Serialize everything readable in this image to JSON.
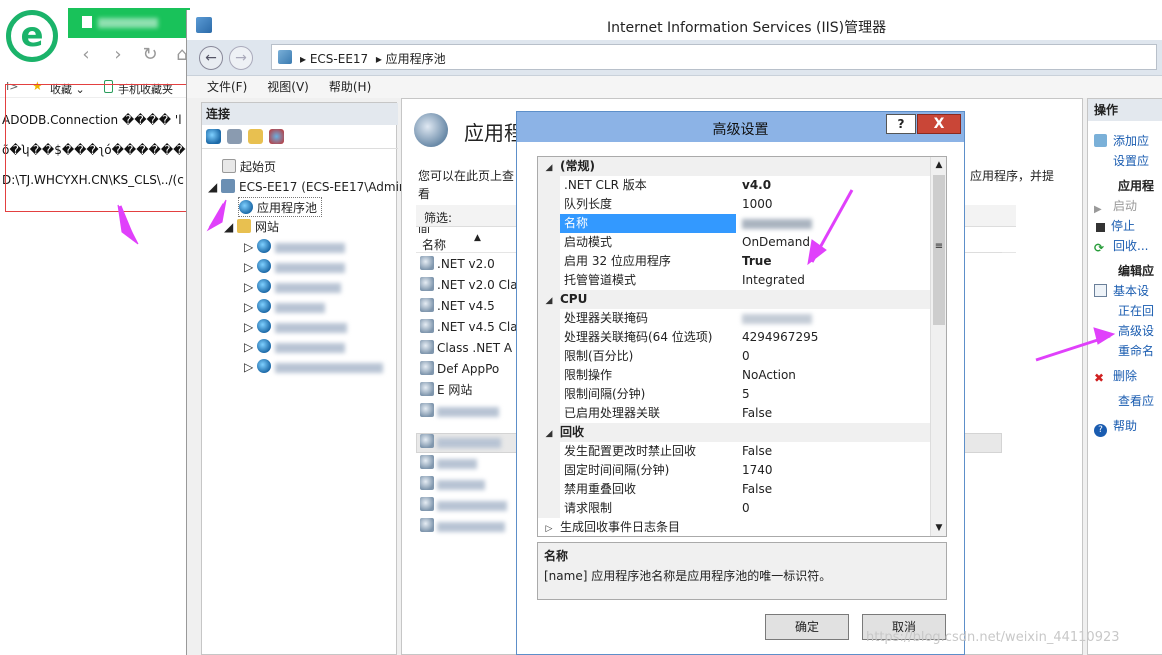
{
  "browser": {
    "logo_letter": "e",
    "bookmarks": {
      "separator": "I>",
      "favorites": "收藏",
      "mobile_favorites": "手机收藏夹"
    },
    "content_lines": [
      "ADODB.Connection  ���� 'l",
      "õ�ʮ��$���ʅó�������",
      "D:\\TJ.WHCYXH.CN\\KS_CLS\\../(c"
    ]
  },
  "iis": {
    "title": "Internet Information Services (IIS)管理器",
    "breadcrumb": [
      "ECS-EE17",
      "应用程序池"
    ],
    "menu": [
      "文件(F)",
      "视图(V)",
      "帮助(H)"
    ],
    "connections": {
      "header": "连接",
      "tree": {
        "start_page": "起始页",
        "server": "ECS-EE17 (ECS-EE17\\Admir",
        "app_pools": "应用程序池",
        "sites": "网站"
      }
    },
    "center": {
      "title": "应用程",
      "desc_left": "您可以在此页上查看\n供不同应用程序之间",
      "desc_right": "应用程序，并提",
      "filter_label": "筛选:",
      "column_name": "名称",
      "pools": [
        ".NET v2.0",
        ".NET v2.0 Clas",
        ".NET v4.5",
        ".NET v4.5 Clas",
        "Class   .NET A",
        "Def   AppPo",
        "E        网站"
      ]
    },
    "actions": {
      "header": "操作",
      "items": [
        {
          "label": "添加应",
          "kind": "link"
        },
        {
          "label": "设置应",
          "kind": "link"
        },
        {
          "label": "应用程",
          "kind": "header"
        },
        {
          "label": "启动",
          "kind": "disabled"
        },
        {
          "label": "停止",
          "kind": "link"
        },
        {
          "label": "回收...",
          "kind": "link"
        },
        {
          "label": "编辑应",
          "kind": "header"
        },
        {
          "label": "基本设",
          "kind": "link"
        },
        {
          "label": "正在回",
          "kind": "link"
        },
        {
          "label": "高级设",
          "kind": "link"
        },
        {
          "label": "重命名",
          "kind": "link"
        },
        {
          "label": "删除",
          "kind": "link"
        },
        {
          "label": "查看应",
          "kind": "link"
        },
        {
          "label": "帮助",
          "kind": "link"
        }
      ]
    }
  },
  "dialog": {
    "title": "高级设置",
    "help_glyph": "?",
    "close_glyph": "X",
    "categories": {
      "general": "(常规)",
      "cpu": "CPU",
      "recycling": "回收"
    },
    "general": [
      {
        "key": ".NET CLR 版本",
        "value": "v4.0",
        "bold": true
      },
      {
        "key": "队列长度",
        "value": "1000"
      },
      {
        "key": "名称",
        "value": "",
        "selected": true
      },
      {
        "key": "启动模式",
        "value": "OnDemand"
      },
      {
        "key": "启用 32 位应用程序",
        "value": "True",
        "bold": true
      },
      {
        "key": "托管管道模式",
        "value": "Integrated"
      }
    ],
    "cpu": [
      {
        "key": "处理器关联掩码",
        "value": ""
      },
      {
        "key": "处理器关联掩码(64 位选项)",
        "value": "4294967295"
      },
      {
        "key": "限制(百分比)",
        "value": "0"
      },
      {
        "key": "限制操作",
        "value": "NoAction"
      },
      {
        "key": "限制间隔(分钟)",
        "value": "5"
      },
      {
        "key": "已启用处理器关联",
        "value": "False"
      }
    ],
    "recycling": [
      {
        "key": "发生配置更改时禁止回收",
        "value": "False"
      },
      {
        "key": "固定时间间隔(分钟)",
        "value": "1740"
      },
      {
        "key": "禁用重叠回收",
        "value": "False"
      },
      {
        "key": "请求限制",
        "value": "0"
      }
    ],
    "collapsed_item": "生成回收事件日志条目",
    "description": {
      "title": "名称",
      "text": "[name] 应用程序池名称是应用程序池的唯一标识符。"
    },
    "ok_label": "确定",
    "cancel_label": "取消"
  },
  "watermark": "https://blog.csdn.net/weixin_44110923",
  "colors": {
    "accent": "#8cb3e6",
    "selection": "#3399ff",
    "annotation": "#e040fb",
    "redbox": "#e34040",
    "browser_green": "#19c25a"
  }
}
